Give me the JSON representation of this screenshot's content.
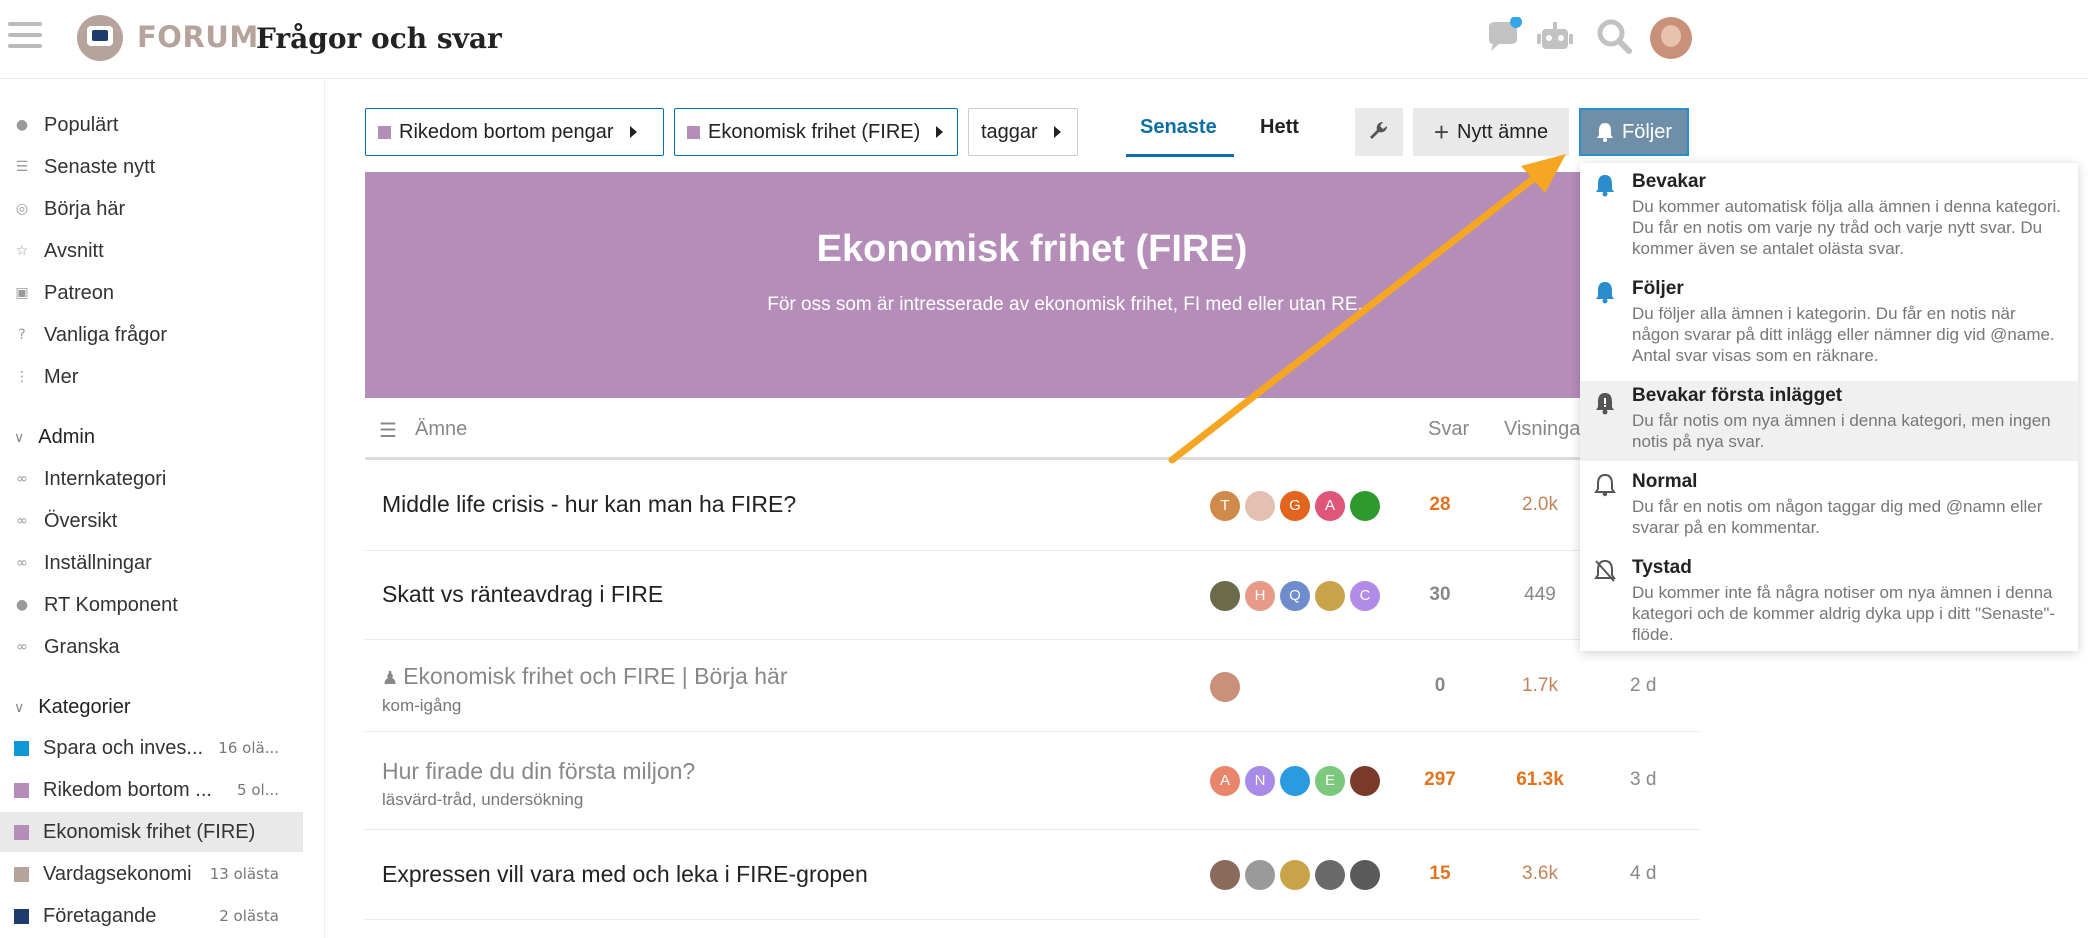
{
  "header": {
    "brand": "FORUM",
    "site_title": "Frågor och svar"
  },
  "sidebar": {
    "nav": [
      {
        "label": "Populärt",
        "icon": "comments-icon"
      },
      {
        "label": "Senaste nytt",
        "icon": "layers-icon"
      },
      {
        "label": "Börja här",
        "icon": "target-icon"
      },
      {
        "label": "Avsnitt",
        "icon": "star-icon"
      },
      {
        "label": "Patreon",
        "icon": "gift-icon"
      },
      {
        "label": "Vanliga frågor",
        "icon": "question-icon"
      },
      {
        "label": "Mer",
        "icon": "ellipsis-icon"
      }
    ],
    "admin_title": "Admin",
    "admin": [
      {
        "label": "Internkategori",
        "icon": "link-icon"
      },
      {
        "label": "Översikt",
        "icon": "link-icon"
      },
      {
        "label": "Inställningar",
        "icon": "link-icon"
      },
      {
        "label": "RT Komponent",
        "icon": "user-icon"
      },
      {
        "label": "Granska",
        "icon": "link-icon"
      }
    ],
    "categories_title": "Kategorier",
    "categories": [
      {
        "label": "Spara och inves...",
        "count": "16 olä...",
        "color": "#0e99d6"
      },
      {
        "label": "Rikedom bortom ...",
        "count": "5 ol...",
        "color": "#b58db9"
      },
      {
        "label": "Ekonomisk frihet (FIRE)",
        "count": "",
        "color": "#b58db9"
      },
      {
        "label": "Vardagsekonomi",
        "count": "13 olästa",
        "color": "#b6a39b"
      },
      {
        "label": "Företagande",
        "count": "2 olästa",
        "color": "#1f3b6e"
      }
    ]
  },
  "breadcrumbs": [
    {
      "label": "Rikedom bortom pengar"
    },
    {
      "label": "Ekonomisk frihet (FIRE)"
    },
    {
      "label": "taggar"
    }
  ],
  "tabs": {
    "latest": "Senaste",
    "hot": "Hett"
  },
  "buttons": {
    "new_topic": "Nytt ämne",
    "following": "Följer"
  },
  "banner": {
    "title": "Ekonomisk frihet (FIRE)",
    "description": "För oss som är intresserade av ekonomisk frihet, FI med eller utan RE."
  },
  "table": {
    "col_topic": "Ämne",
    "col_replies": "Svar",
    "col_views": "Visningar",
    "rows": [
      {
        "title": "Middle life crisis - hur kan man ha FIRE?",
        "tags": "",
        "replies": "28",
        "views": "2.0k",
        "activity": "",
        "read": false,
        "posters": [
          {
            "l": "T",
            "c": "#d08a4a"
          },
          {
            "l": "",
            "c": "#e3c1b0"
          },
          {
            "l": "G",
            "c": "#e2641f"
          },
          {
            "l": "A",
            "c": "#e0567a"
          },
          {
            "l": "",
            "c": "#2e9a2e"
          }
        ]
      },
      {
        "title": "Skatt vs ränteavdrag i FIRE",
        "tags": "",
        "replies": "30",
        "views": "449",
        "activity": "",
        "read": false,
        "posters": [
          {
            "l": "",
            "c": "#6b6a4a"
          },
          {
            "l": "H",
            "c": "#e89a88"
          },
          {
            "l": "Q",
            "c": "#6f8ccc"
          },
          {
            "l": "",
            "c": "#c9a34a"
          },
          {
            "l": "C",
            "c": "#b28ae8"
          }
        ]
      },
      {
        "title": "Ekonomisk frihet och FIRE | Börja här",
        "tags": "kom-igång",
        "replies": "0",
        "views": "1.7k",
        "activity": "2 d",
        "read": true,
        "pinned": true,
        "posters": [
          {
            "l": "",
            "c": "#c9907a"
          }
        ]
      },
      {
        "title": "Hur firade du din första miljon?",
        "tags": "läsvärd-tråd, undersökning",
        "replies": "297",
        "views": "61.3k",
        "activity": "3 d",
        "read": true,
        "posters": [
          {
            "l": "A",
            "c": "#e8856a"
          },
          {
            "l": "N",
            "c": "#a88ae8"
          },
          {
            "l": "",
            "c": "#2a9be0"
          },
          {
            "l": "E",
            "c": "#7cc87c"
          },
          {
            "l": "",
            "c": "#7a3a2a"
          }
        ]
      },
      {
        "title": "Expressen vill vara med och leka i FIRE-gropen",
        "tags": "",
        "replies": "15",
        "views": "3.6k",
        "activity": "4 d",
        "read": false,
        "posters": [
          {
            "l": "",
            "c": "#8a6a5a"
          },
          {
            "l": "",
            "c": "#9a9a9a"
          },
          {
            "l": "",
            "c": "#c9a34a"
          },
          {
            "l": "",
            "c": "#6a6a6a"
          },
          {
            "l": "",
            "c": "#5a5a5a"
          }
        ]
      }
    ]
  },
  "dropdown": [
    {
      "title": "Bevakar",
      "desc": "Du kommer automatisk följa alla ämnen i denna kategori. Du får en notis om varje ny tråd och varje nytt svar. Du kommer även se antalet olästa svar.",
      "icon": "bell-icon"
    },
    {
      "title": "Följer",
      "desc": "Du följer alla ämnen i kategorin. Du får en notis när någon svarar på ditt inlägg eller nämner dig vid @name. Antal svar visas som en räknare.",
      "icon": "bell-icon"
    },
    {
      "title": "Bevakar första inlägget",
      "desc": "Du får notis om nya ämnen i denna kategori, men ingen notis på nya svar.",
      "icon": "bell-exclaim-icon"
    },
    {
      "title": "Normal",
      "desc": "Du får en notis om någon taggar dig med @namn eller svarar på en kommentar.",
      "icon": "bell-outline-icon"
    },
    {
      "title": "Tystad",
      "desc": "Du kommer inte få några notiser om nya ämnen i denna kategori och de kommer aldrig dyka upp i ditt \"Senaste\"-flöde.",
      "icon": "bell-slash-icon"
    }
  ],
  "colors": {
    "accent": "#0b6fa6",
    "category": "#b58db9",
    "highlight": "#e2741f",
    "arrow": "#f5a623"
  }
}
